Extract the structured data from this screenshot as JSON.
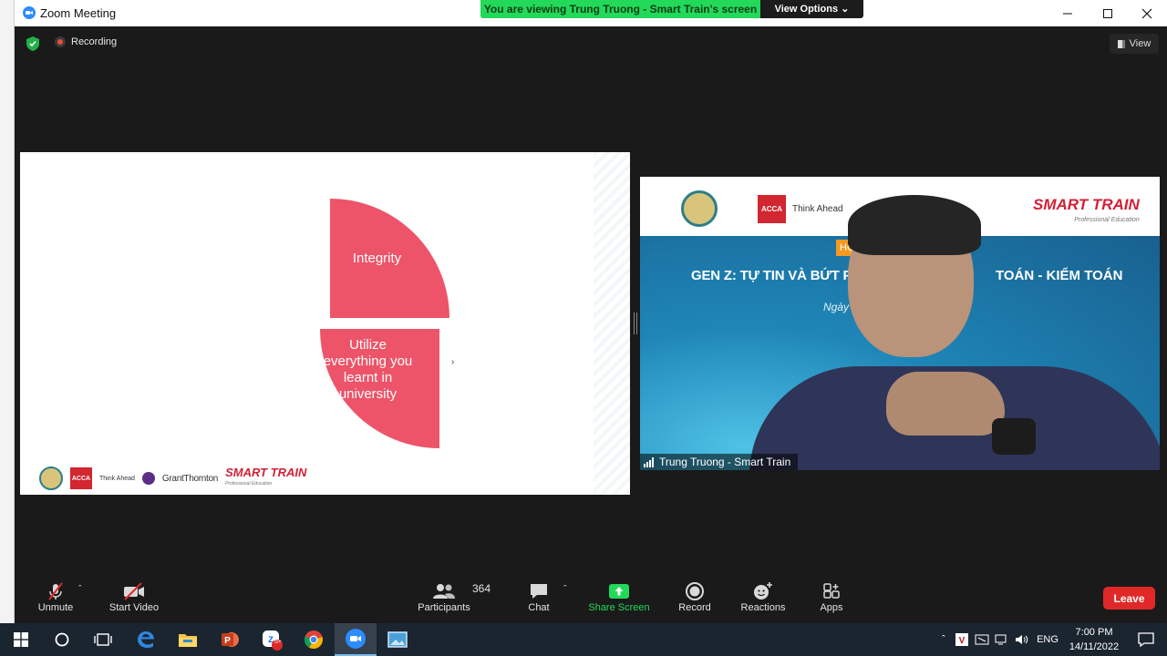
{
  "window": {
    "title": "Zoom Meeting",
    "minimize_icon": "minimize-icon",
    "maximize_icon": "maximize-icon",
    "close_icon": "close-icon"
  },
  "share_banner": {
    "text": "You are viewing Trung Truong - Smart Train's screen",
    "view_options_label": "View Options",
    "color": "#23d959"
  },
  "status": {
    "recording_label": "Recording",
    "view_label": "View"
  },
  "slide": {
    "top_shape_text": "Integrity",
    "bottom_shape_text": "Utilize everything you learnt in university",
    "arrow": "›",
    "shape_color": "#ed5469",
    "logos": {
      "acca": "ACCA",
      "think_ahead": "Think Ahead",
      "grant_thornton": "GrantThornton",
      "smart_train": "SMART TRAIN",
      "smart_train_sub": "Professional Education"
    }
  },
  "video": {
    "acca": "ACCA",
    "think_ahead": "Think Ahead",
    "smart_train": "SMART TRAIN",
    "smart_train_sub": "Professional Education",
    "badge": "HỘ",
    "title_left": "GEN Z: TỰ TIN VÀ BỨT PHÁ",
    "title_right": "TOÁN - KIỂM TOÁN",
    "date_label": "Ngày",
    "participant_name": "Trung Truong - Smart Train"
  },
  "toolbar": {
    "unmute": "Unmute",
    "start_video": "Start Video",
    "participants": "Participants",
    "participants_count": "364",
    "chat": "Chat",
    "share_screen": "Share Screen",
    "record": "Record",
    "reactions": "Reactions",
    "apps": "Apps",
    "leave": "Leave",
    "leave_color": "#e02828"
  },
  "taskbar": {
    "language": "ENG",
    "time": "7:00 PM",
    "date": "14/11/2022",
    "zalo_badge": "5+",
    "icons": [
      "windows-start-icon",
      "search-circle-icon",
      "task-view-icon",
      "edge-icon",
      "file-explorer-icon",
      "powerpoint-icon",
      "zalo-icon",
      "chrome-icon",
      "zoom-icon",
      "photos-icon"
    ]
  }
}
